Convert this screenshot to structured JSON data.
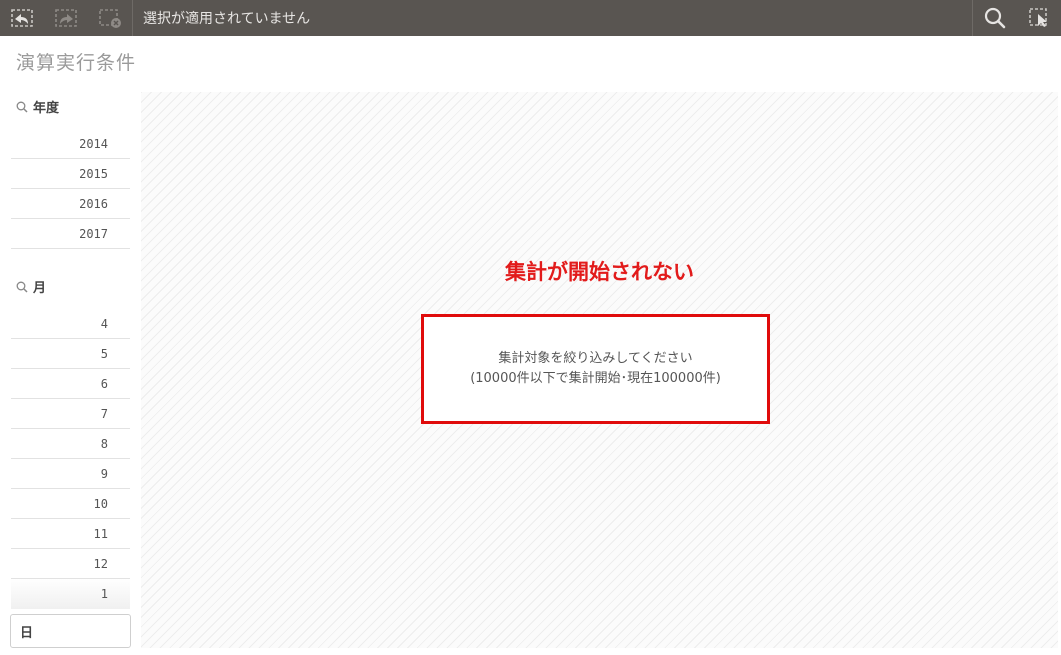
{
  "toolbar": {
    "status_text": "選択が適用されていません",
    "icons": [
      "back-selection-icon",
      "forward-selection-icon",
      "clear-selections-icon",
      "search-icon",
      "smart-select-icon"
    ]
  },
  "sheet": {
    "title": "演算実行条件"
  },
  "filters": {
    "year": {
      "title": "年度",
      "items": [
        "2014",
        "2015",
        "2016",
        "2017"
      ]
    },
    "month": {
      "title": "月",
      "items": [
        "4",
        "5",
        "6",
        "7",
        "8",
        "9",
        "10",
        "11",
        "12",
        "1"
      ]
    },
    "day": {
      "title": "日"
    }
  },
  "main": {
    "heading": "集計が開始されない",
    "message_line1": "集計対象を絞り込みしてください",
    "message_line2": "(10000件以下で集計開始･現在100000件)"
  },
  "colors": {
    "toolbar_bg": "#595551",
    "heading_red": "#e21b1b",
    "box_border": "#e00b0b"
  }
}
